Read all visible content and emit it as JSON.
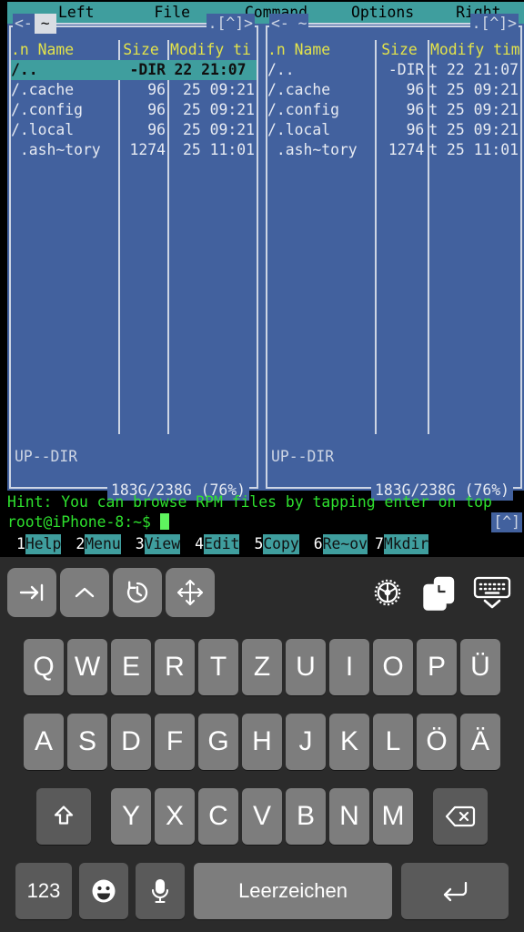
{
  "terminal": {
    "menubar": {
      "items": [
        "Left",
        "File",
        "Command",
        "Options",
        "Right"
      ]
    },
    "left_panel": {
      "title": "~",
      "title_active": true,
      "headers": {
        "name": ".n Name",
        "size": "Size",
        "time": "Modify ti"
      },
      "rows": [
        {
          "name": "/..",
          "size": "-DIR",
          "time": "22 21:07",
          "selected": true
        },
        {
          "name": "/.cache",
          "size": "96",
          "time": "25 09:21",
          "selected": false
        },
        {
          "name": "/.config",
          "size": "96",
          "time": "25 09:21",
          "selected": false
        },
        {
          "name": "/.local",
          "size": "96",
          "time": "25 09:21",
          "selected": false
        },
        {
          "name": " .ash~tory",
          "size": "1274",
          "time": "25 11:01",
          "selected": false
        }
      ],
      "mini_status": "UP--DIR",
      "free_space": "183G/238G (76%)",
      "corner_left": "<-",
      "corner_right": ".[^]>"
    },
    "right_panel": {
      "title": "~",
      "title_active": false,
      "headers": {
        "name": ".n Name",
        "size": "Size",
        "time": "Modify tim"
      },
      "rows": [
        {
          "name": "/..",
          "size": "-DIR",
          "time": "t 22 21:07",
          "selected": false
        },
        {
          "name": "/.cache",
          "size": "96",
          "time": "t 25 09:21",
          "selected": false
        },
        {
          "name": "/.config",
          "size": "96",
          "time": "t 25 09:21",
          "selected": false
        },
        {
          "name": "/.local",
          "size": "96",
          "time": "t 25 09:21",
          "selected": false
        },
        {
          "name": " .ash~tory",
          "size": "1274",
          "time": "t 25 11:01",
          "selected": false
        }
      ],
      "mini_status": "UP--DIR",
      "free_space": "183G/238G (76%)",
      "corner_left": "<- ~",
      "corner_right": ".[^]>"
    },
    "hint": "Hint: You can browse RPM files by tapping enter on top",
    "prompt": "root@iPhone-8:~$ ",
    "scroll_up_badge": "[^]",
    "function_keys": [
      {
        "num": "1",
        "label": "Help"
      },
      {
        "num": "2",
        "label": "Menu"
      },
      {
        "num": "3",
        "label": "View"
      },
      {
        "num": "4",
        "label": "Edit"
      },
      {
        "num": "5",
        "label": "Copy"
      },
      {
        "num": "6",
        "label": "Re~ov"
      },
      {
        "num": "7",
        "label": "Mkdir"
      }
    ],
    "colors": {
      "panel_bg": "#42619e",
      "accent_teal": "#3f9e9e",
      "header_yellow": "#e3e34a",
      "terminal_green": "#2ee02e",
      "panel_border": "#cdd5e4"
    }
  },
  "toolbar": {
    "left_buttons": [
      {
        "icon": "tab-icon"
      },
      {
        "icon": "ctrl-caret-icon"
      },
      {
        "icon": "history-rotate-icon"
      },
      {
        "icon": "arrow-keys-move-icon"
      }
    ],
    "right_icons": [
      {
        "icon": "gear-icon"
      },
      {
        "icon": "paste-clipboard-icon"
      },
      {
        "icon": "hide-keyboard-icon"
      }
    ]
  },
  "keyboard": {
    "layout": "QWERTZ",
    "row1": [
      "Q",
      "W",
      "E",
      "R",
      "T",
      "Z",
      "U",
      "I",
      "O",
      "P",
      "Ü"
    ],
    "row2": [
      "A",
      "S",
      "D",
      "F",
      "G",
      "H",
      "J",
      "K",
      "L",
      "Ö",
      "Ä"
    ],
    "row3": [
      "Y",
      "X",
      "C",
      "V",
      "B",
      "N",
      "M"
    ],
    "shift_icon": "shift-up-arrow-icon",
    "backspace_icon": "backspace-icon",
    "numbers_key": "123",
    "emoji_icon": "emoji-smiley-icon",
    "mic_icon": "microphone-icon",
    "space_label": "Leerzeichen",
    "return_icon": "return-enter-icon"
  }
}
